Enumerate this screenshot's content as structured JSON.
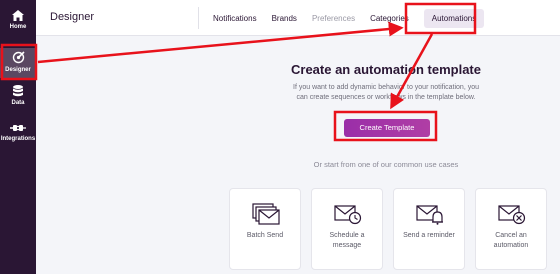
{
  "sidebar": {
    "items": [
      {
        "label": "Home",
        "icon": "home-icon",
        "active": false
      },
      {
        "label": "Designer",
        "icon": "designer-icon",
        "active": true
      },
      {
        "label": "Data",
        "icon": "database-icon",
        "active": false
      },
      {
        "label": "Integrations",
        "icon": "plug-icon",
        "active": false
      }
    ]
  },
  "header": {
    "title": "Designer",
    "tabs": [
      {
        "label": "Notifications",
        "state": "normal"
      },
      {
        "label": "Brands",
        "state": "normal"
      },
      {
        "label": "Preferences",
        "state": "disabled"
      },
      {
        "label": "Categories",
        "state": "normal"
      },
      {
        "label": "Automations",
        "state": "active"
      }
    ]
  },
  "main": {
    "heading": "Create an automation template",
    "description_line1": "If you want to add dynamic behavior to your notification, you",
    "description_line2": "can create sequences or workflows in the template below.",
    "create_button": "Create Template",
    "or_text": "Or start from one of our common use cases",
    "use_cases": [
      {
        "label": "Batch Send",
        "icon": "envelopes-icon"
      },
      {
        "label": "Schedule a message",
        "icon": "scheduled-envelope-icon"
      },
      {
        "label": "Send a reminder",
        "icon": "bell-envelope-icon"
      },
      {
        "label": "Cancel an automation",
        "icon": "cancel-envelope-icon"
      }
    ]
  },
  "colors": {
    "sidebar_bg": "#2a1634",
    "accent": "#9a2ea8",
    "annotation_red": "#e8121b"
  }
}
